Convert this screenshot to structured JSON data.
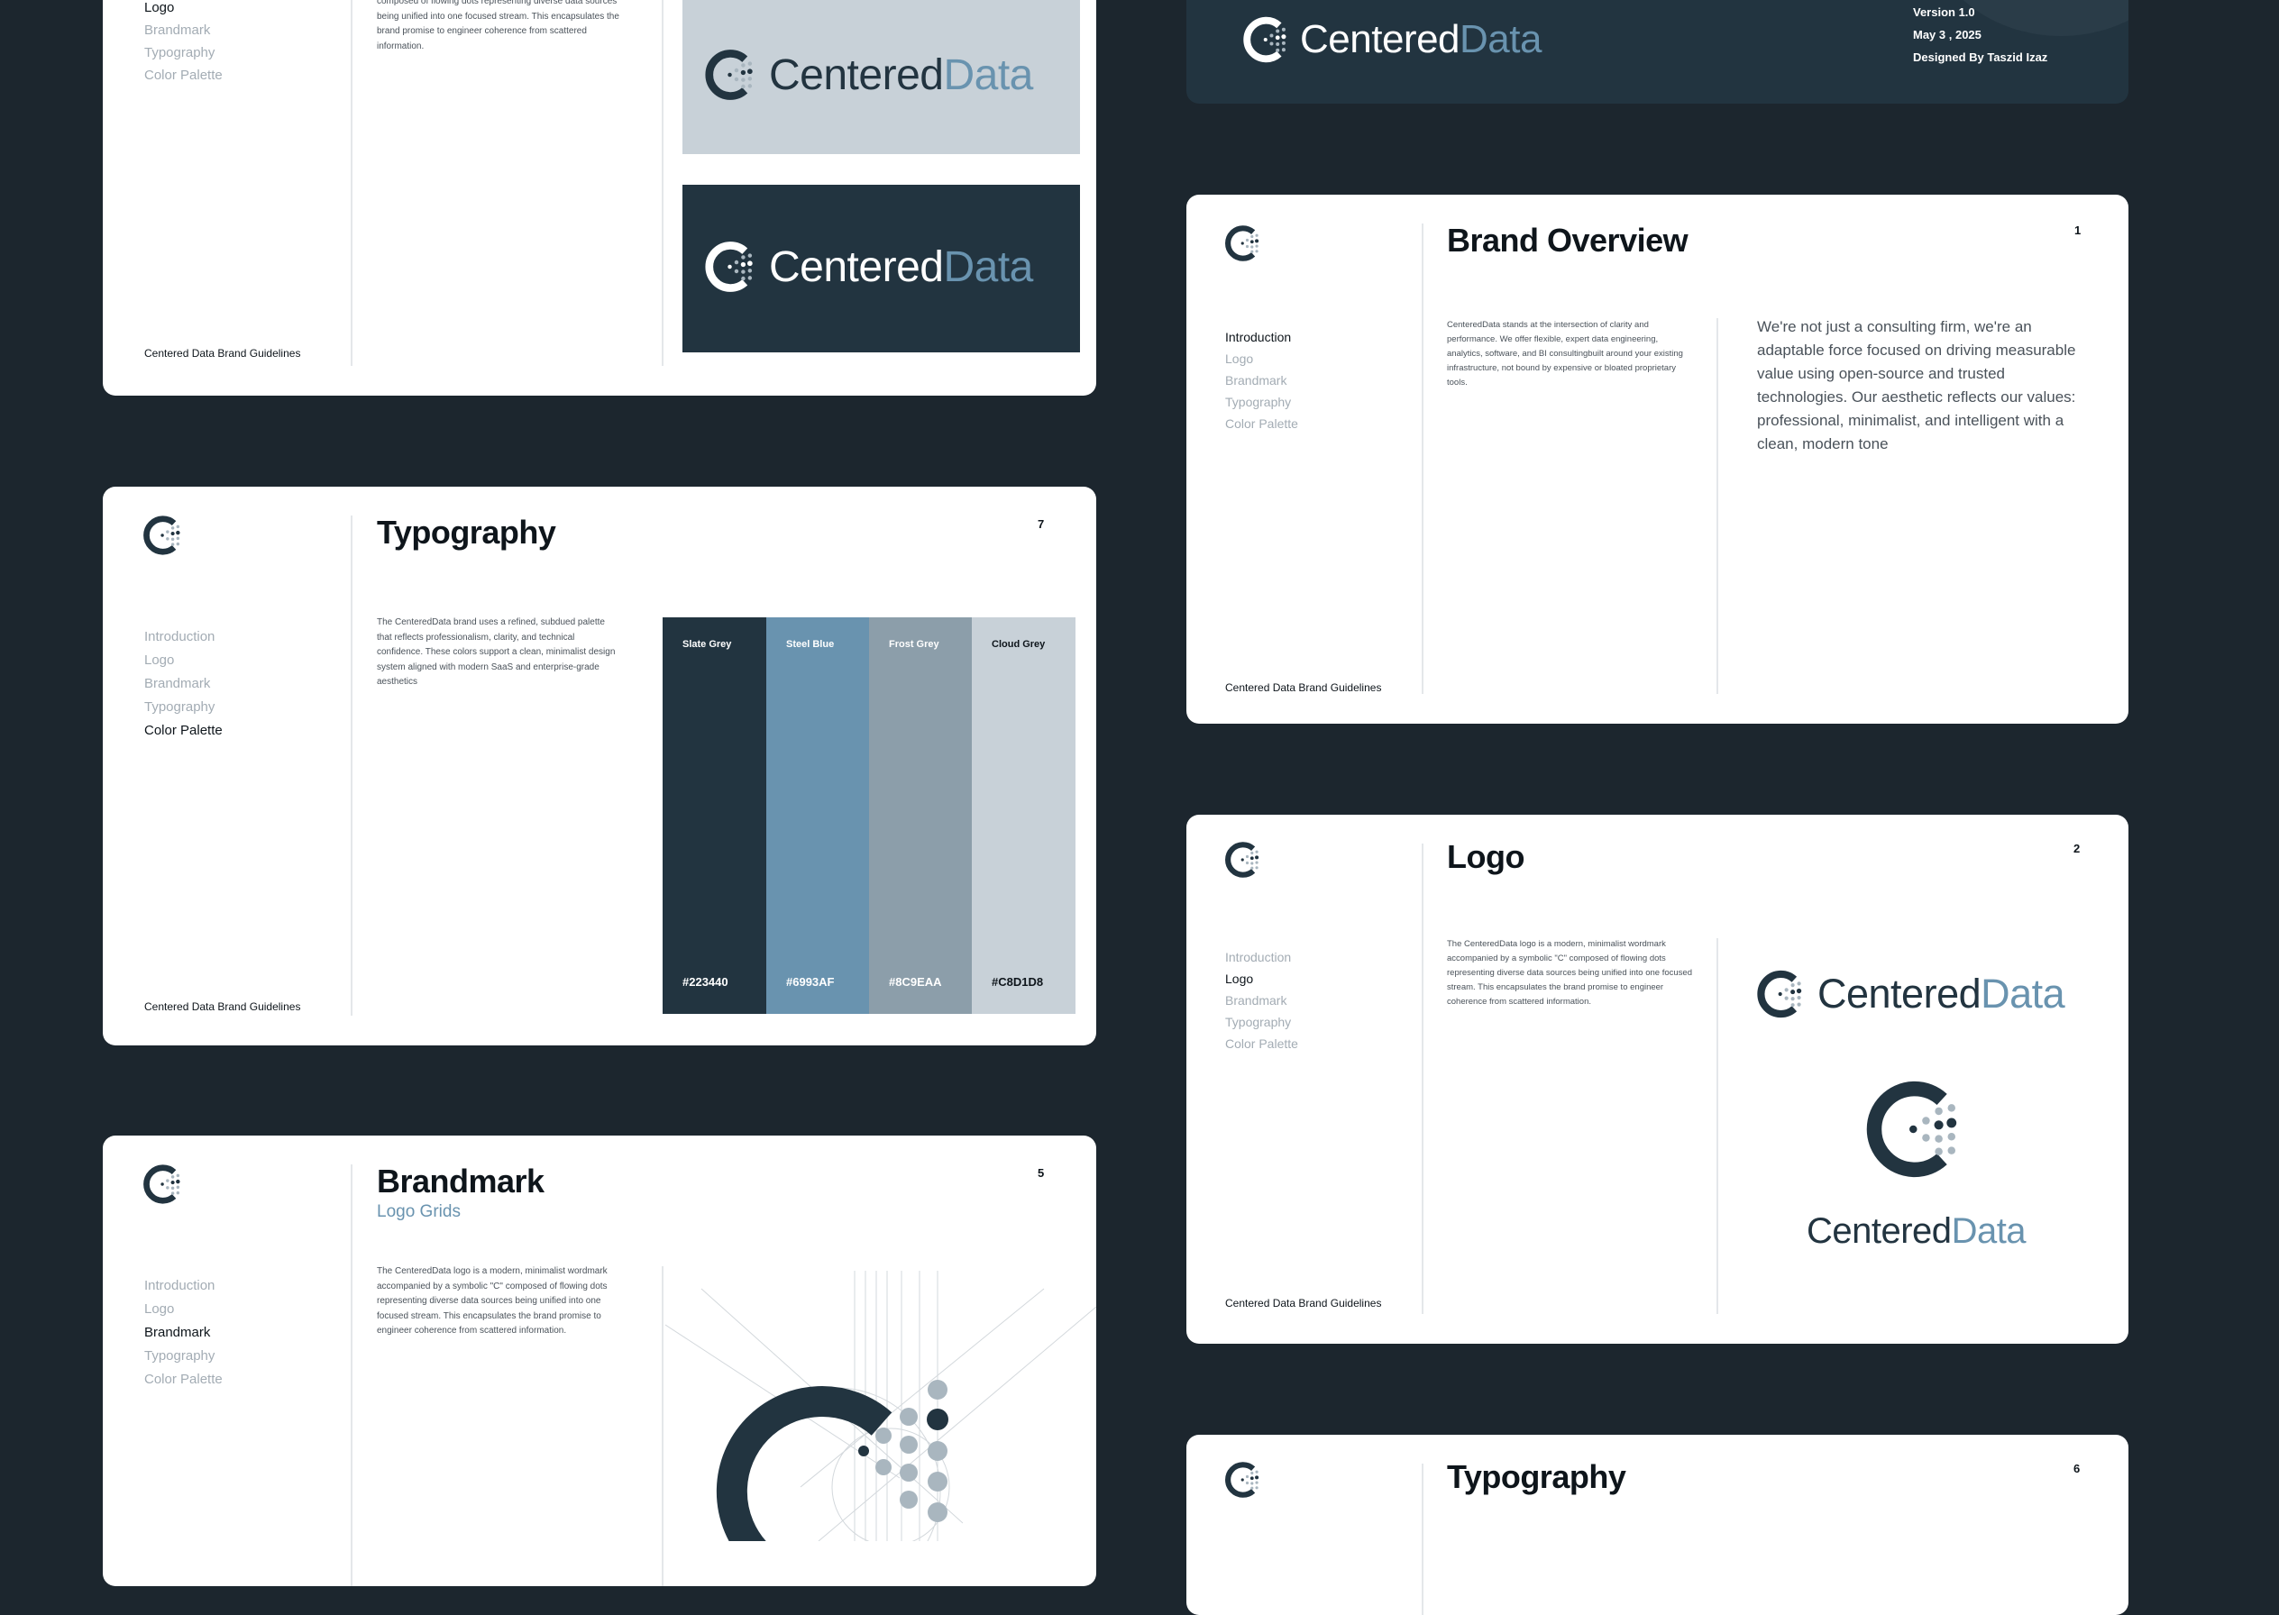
{
  "colors": {
    "background": "#1c262e",
    "slate_grey": "#223440",
    "steel_blue": "#6993AF",
    "frost_grey": "#8C9EAA",
    "cloud_grey": "#C8D1D8"
  },
  "brand": {
    "wordmark_part1": "Centered",
    "wordmark_part2": "Data",
    "footer": "Centered Data Brand Guidelines",
    "icon": "centereddata-c-dots-icon"
  },
  "nav": {
    "introduction": "Introduction",
    "logo": "Logo",
    "brandmark": "Brandmark",
    "typography": "Typography",
    "color_palette": "Color Palette"
  },
  "cover": {
    "version": "Version 1.0",
    "date": "May 3 , 2025",
    "designer": "Designed By Taszid Izaz"
  },
  "logo_top": {
    "body": "composed of flowing dots representing diverse data sources being unified into one focused stream. This encapsulates the brand promise to engineer coherence from scattered information."
  },
  "brand_overview": {
    "title": "Brand Overview",
    "page": "1",
    "body": "CenteredData stands at the intersection of clarity and performance. We offer flexible, expert data engineering, analytics, software, and BI consultingbuilt around your existing infrastructure, not bound by expensive or bloated proprietary tools.",
    "quote": "We're not just a consulting firm, we're an adaptable force focused on driving measurable value using open-source and trusted technologies. Our aesthetic reflects our values: professional, minimalist, and intelligent with a clean, modern tone"
  },
  "color_page": {
    "title": "Typography",
    "page": "7",
    "body": "The CenteredData brand uses a refined, subdued palette that reflects professionalism, clarity, and technical confidence. These colors support a clean, minimalist design system aligned with modern SaaS and enterprise-grade aesthetics",
    "swatches": [
      {
        "name": "Slate Grey",
        "hex": "#223440"
      },
      {
        "name": "Steel Blue",
        "hex": "#6993AF"
      },
      {
        "name": "Frost Grey",
        "hex": "#8C9EAA"
      },
      {
        "name": "Cloud Grey",
        "hex": "#C8D1D8"
      }
    ]
  },
  "logo_page": {
    "title": "Logo",
    "page": "2",
    "body": "The CenteredData logo is a modern, minimalist wordmark accompanied by a symbolic \"C\" composed of flowing dots representing diverse data sources being unified into one focused stream. This encapsulates the brand promise to engineer coherence from scattered information."
  },
  "brandmark_page": {
    "title": "Brandmark",
    "subtitle": "Logo Grids",
    "page": "5",
    "body": "The CenteredData logo is a modern, minimalist wordmark accompanied by a symbolic \"C\" composed of flowing dots representing diverse data sources being unified into one focused stream. This encapsulates the brand promise to engineer coherence from scattered information."
  },
  "typography_page": {
    "title": "Typography",
    "page": "6"
  }
}
